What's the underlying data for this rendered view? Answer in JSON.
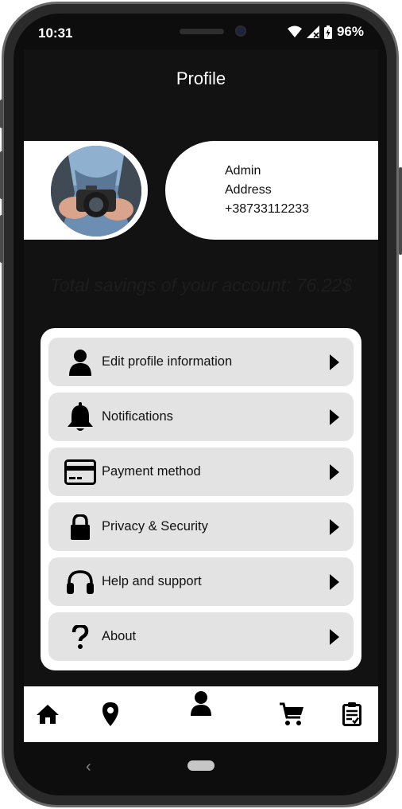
{
  "status": {
    "time": "10:31",
    "battery": "96%"
  },
  "header": {
    "title": "Profile"
  },
  "profile": {
    "name": "Admin",
    "address": "Address",
    "phone": "+38733112233"
  },
  "savings_text": "Total savings of your account: 76.22$",
  "menu": [
    {
      "label": "Edit profile information",
      "icon": "person-icon"
    },
    {
      "label": "Notifications",
      "icon": "bell-icon"
    },
    {
      "label": "Payment method",
      "icon": "credit-card-icon"
    },
    {
      "label": "Privacy & Security",
      "icon": "lock-icon"
    },
    {
      "label": "Help and support",
      "icon": "headphones-icon"
    },
    {
      "label": "About",
      "icon": "question-icon"
    }
  ],
  "bottom_nav": [
    "home-icon",
    "location-pin-icon",
    "profile-icon",
    "cart-icon",
    "clipboard-icon"
  ]
}
